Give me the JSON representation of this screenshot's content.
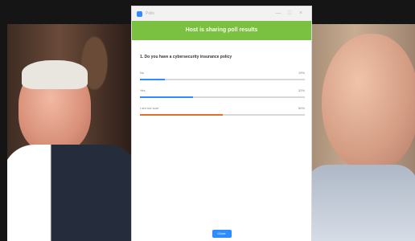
{
  "window": {
    "title": "Polls",
    "controls": {
      "minimize": "—",
      "maximize": "□",
      "close": "×"
    },
    "icon": "zoom-app-icon"
  },
  "poll": {
    "banner": "Host is sharing poll results",
    "question": "1. Do you have a cybersecurity insurance policy",
    "answers": [
      {
        "label": "No",
        "percent_text": "19%",
        "value": 0.15,
        "color": "#2d8cff"
      },
      {
        "label": "Yes",
        "percent_text": "32%",
        "value": 0.32,
        "color": "#2d8cff"
      },
      {
        "label": "I am not sure",
        "percent_text": "50%",
        "value": 0.5,
        "color": "#e86e2f"
      }
    ],
    "close_label": "Close"
  },
  "colors": {
    "banner": "#7ac142",
    "button": "#2d8cff"
  }
}
